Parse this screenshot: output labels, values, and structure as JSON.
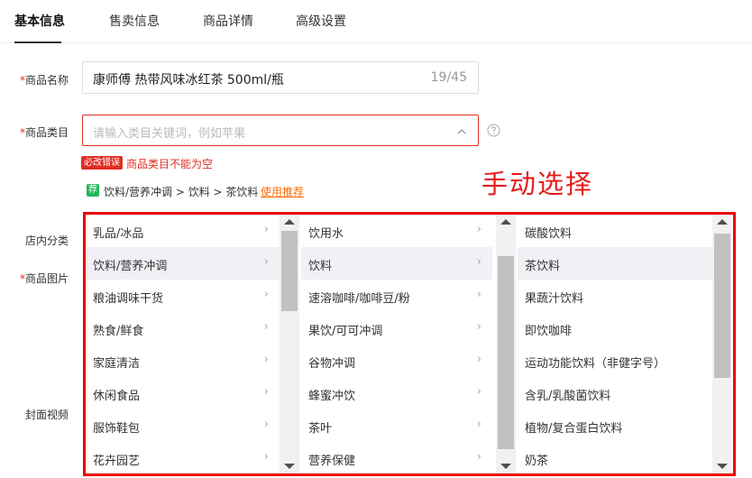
{
  "tabs": [
    {
      "label": "基本信息"
    },
    {
      "label": "售卖信息"
    },
    {
      "label": "商品详情"
    },
    {
      "label": "高级设置"
    }
  ],
  "form": {
    "required_mark": "*",
    "product_name_label": "商品名称",
    "product_name_value": "康师傅 热带风味冰红茶 500ml/瓶",
    "product_name_count": "19/45",
    "category_label": "商品类目",
    "category_placeholder": "请输入类目关键词，例如苹果",
    "error_badge": "必改错误",
    "error_text": "商品类目不能为空",
    "recommend_badge": "荐",
    "recommend_path": "饮料/营养冲调 > 饮料 > 茶饮料",
    "recommend_link": "使用推荐",
    "shop_category_label": "店内分类",
    "product_images_label": "商品图片",
    "cover_video_label": "封面视频"
  },
  "annotation": "手动选择",
  "cascader": {
    "column1": [
      {
        "label": "乳品/冰品",
        "selected": false
      },
      {
        "label": "饮料/营养冲调",
        "selected": true
      },
      {
        "label": "粮油调味干货",
        "selected": false
      },
      {
        "label": "熟食/鲜食",
        "selected": false
      },
      {
        "label": "家庭清洁",
        "selected": false
      },
      {
        "label": "休闲食品",
        "selected": false
      },
      {
        "label": "服饰鞋包",
        "selected": false
      },
      {
        "label": "花卉园艺",
        "selected": false
      }
    ],
    "column2": [
      {
        "label": "饮用水",
        "selected": false
      },
      {
        "label": "饮料",
        "selected": true
      },
      {
        "label": "速溶咖啡/咖啡豆/粉",
        "selected": false
      },
      {
        "label": "果饮/可可冲调",
        "selected": false
      },
      {
        "label": "谷物冲调",
        "selected": false
      },
      {
        "label": "蜂蜜冲饮",
        "selected": false
      },
      {
        "label": "茶叶",
        "selected": false
      },
      {
        "label": "营养保健",
        "selected": false
      }
    ],
    "column3": [
      {
        "label": "碳酸饮料",
        "selected": false
      },
      {
        "label": "茶饮料",
        "selected": true
      },
      {
        "label": "果蔬汁饮料",
        "selected": false
      },
      {
        "label": "即饮咖啡",
        "selected": false
      },
      {
        "label": "运动功能饮料（非健字号）",
        "selected": false
      },
      {
        "label": "含乳/乳酸菌饮料",
        "selected": false
      },
      {
        "label": "植物/复合蛋白饮料",
        "selected": false
      },
      {
        "label": "奶茶",
        "selected": false
      }
    ],
    "arrow_glyph": "›"
  },
  "colors": {
    "error": "#e02e24",
    "recommend_badge": "#1fb85c",
    "link": "#ff6a00",
    "annotation": "#e41b1b",
    "selected_row": "#f0f0f5"
  },
  "icons": {
    "chevron": "chevron-down-icon",
    "help": "question-circle-icon"
  }
}
